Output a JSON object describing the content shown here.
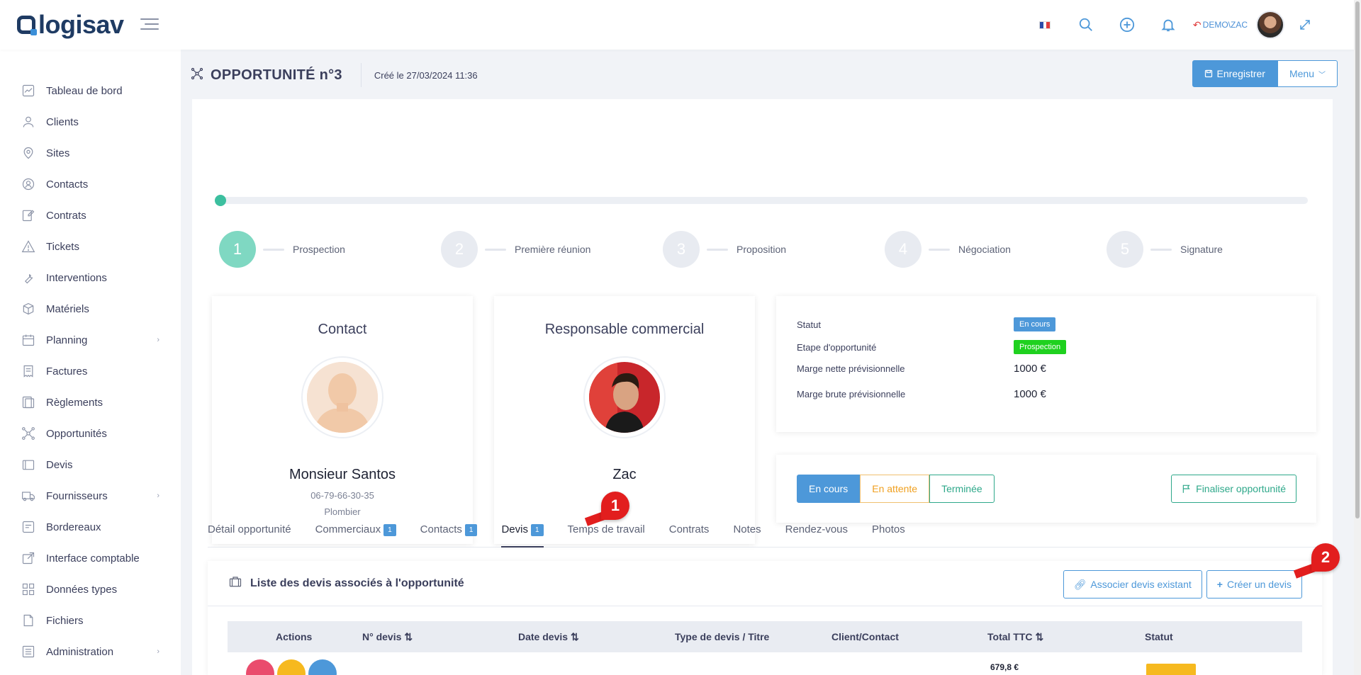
{
  "app": {
    "logo_text": "logisav",
    "user": "DEMO\\ZAC"
  },
  "sidebar": {
    "items": [
      {
        "label": "Tableau de bord",
        "icon": "dashboard-icon"
      },
      {
        "label": "Clients",
        "icon": "users-icon"
      },
      {
        "label": "Sites",
        "icon": "map-pin-icon"
      },
      {
        "label": "Contacts",
        "icon": "contact-icon"
      },
      {
        "label": "Contrats",
        "icon": "edit-icon"
      },
      {
        "label": "Tickets",
        "icon": "warning-icon"
      },
      {
        "label": "Interventions",
        "icon": "wrench-icon"
      },
      {
        "label": "Matériels",
        "icon": "box-icon"
      },
      {
        "label": "Planning",
        "icon": "calendar-icon",
        "chevron": true
      },
      {
        "label": "Factures",
        "icon": "invoice-icon"
      },
      {
        "label": "Règlements",
        "icon": "payment-icon"
      },
      {
        "label": "Opportunités",
        "icon": "network-icon"
      },
      {
        "label": "Devis",
        "icon": "quote-icon"
      },
      {
        "label": "Fournisseurs",
        "icon": "truck-icon",
        "chevron": true
      },
      {
        "label": "Bordereaux",
        "icon": "slip-icon"
      },
      {
        "label": "Interface comptable",
        "icon": "external-link-icon"
      },
      {
        "label": "Données types",
        "icon": "grid-icon"
      },
      {
        "label": "Fichiers",
        "icon": "file-icon"
      },
      {
        "label": "Administration",
        "icon": "sliders-icon",
        "chevron": true
      }
    ]
  },
  "header": {
    "title": "OPPORTUNITÉ n°3",
    "created": "Créé le 27/03/2024 11:36",
    "save_label": "Enregistrer",
    "menu_label": "Menu"
  },
  "progress": {
    "percent": 0
  },
  "steps": [
    {
      "num": "1",
      "label": "Prospection",
      "active": true
    },
    {
      "num": "2",
      "label": "Première réunion",
      "active": false
    },
    {
      "num": "3",
      "label": "Proposition",
      "active": false
    },
    {
      "num": "4",
      "label": "Négociation",
      "active": false
    },
    {
      "num": "5",
      "label": "Signature",
      "active": false
    }
  ],
  "contact": {
    "title": "Contact",
    "name": "Monsieur Santos",
    "phone": "06-79-66-30-35",
    "job": "Plombier"
  },
  "commercial": {
    "title": "Responsable commercial",
    "name": "Zac"
  },
  "info": {
    "statut_label": "Statut",
    "statut_value": "En cours",
    "etape_label": "Etape d'opportunité",
    "etape_value": "Prospection",
    "marge_nette_label": "Marge nette prévisionnelle",
    "marge_nette_value": "1000 €",
    "marge_brute_label": "Marge brute prévisionnelle",
    "marge_brute_value": "1000 €"
  },
  "status_buttons": {
    "en_cours": "En cours",
    "en_attente": "En attente",
    "terminee": "Terminée",
    "finaliser": "Finaliser opportunité"
  },
  "tabs": [
    {
      "label": "Détail opportunité"
    },
    {
      "label": "Commerciaux",
      "count": "1"
    },
    {
      "label": "Contacts",
      "count": "1"
    },
    {
      "label": "Devis",
      "count": "1",
      "active": true
    },
    {
      "label": "Temps de travail"
    },
    {
      "label": "Contrats"
    },
    {
      "label": "Notes"
    },
    {
      "label": "Rendez-vous"
    },
    {
      "label": "Photos"
    }
  ],
  "devis": {
    "title": "Liste des devis associés à l'opportunité",
    "assoc_label": "Associer devis existant",
    "create_label": "Créer un devis",
    "columns": {
      "actions": "Actions",
      "numero": "N° devis",
      "date": "Date devis",
      "type": "Type de devis / Titre",
      "client": "Client/Contact",
      "total": "Total TTC",
      "statut": "Statut"
    },
    "rows": [
      {
        "total": "679,8 €"
      }
    ]
  },
  "markers": {
    "one": "1",
    "two": "2"
  },
  "colors": {
    "accent": "#4d98d9",
    "success": "#3cbf9f",
    "marker": "#e21e1e"
  }
}
